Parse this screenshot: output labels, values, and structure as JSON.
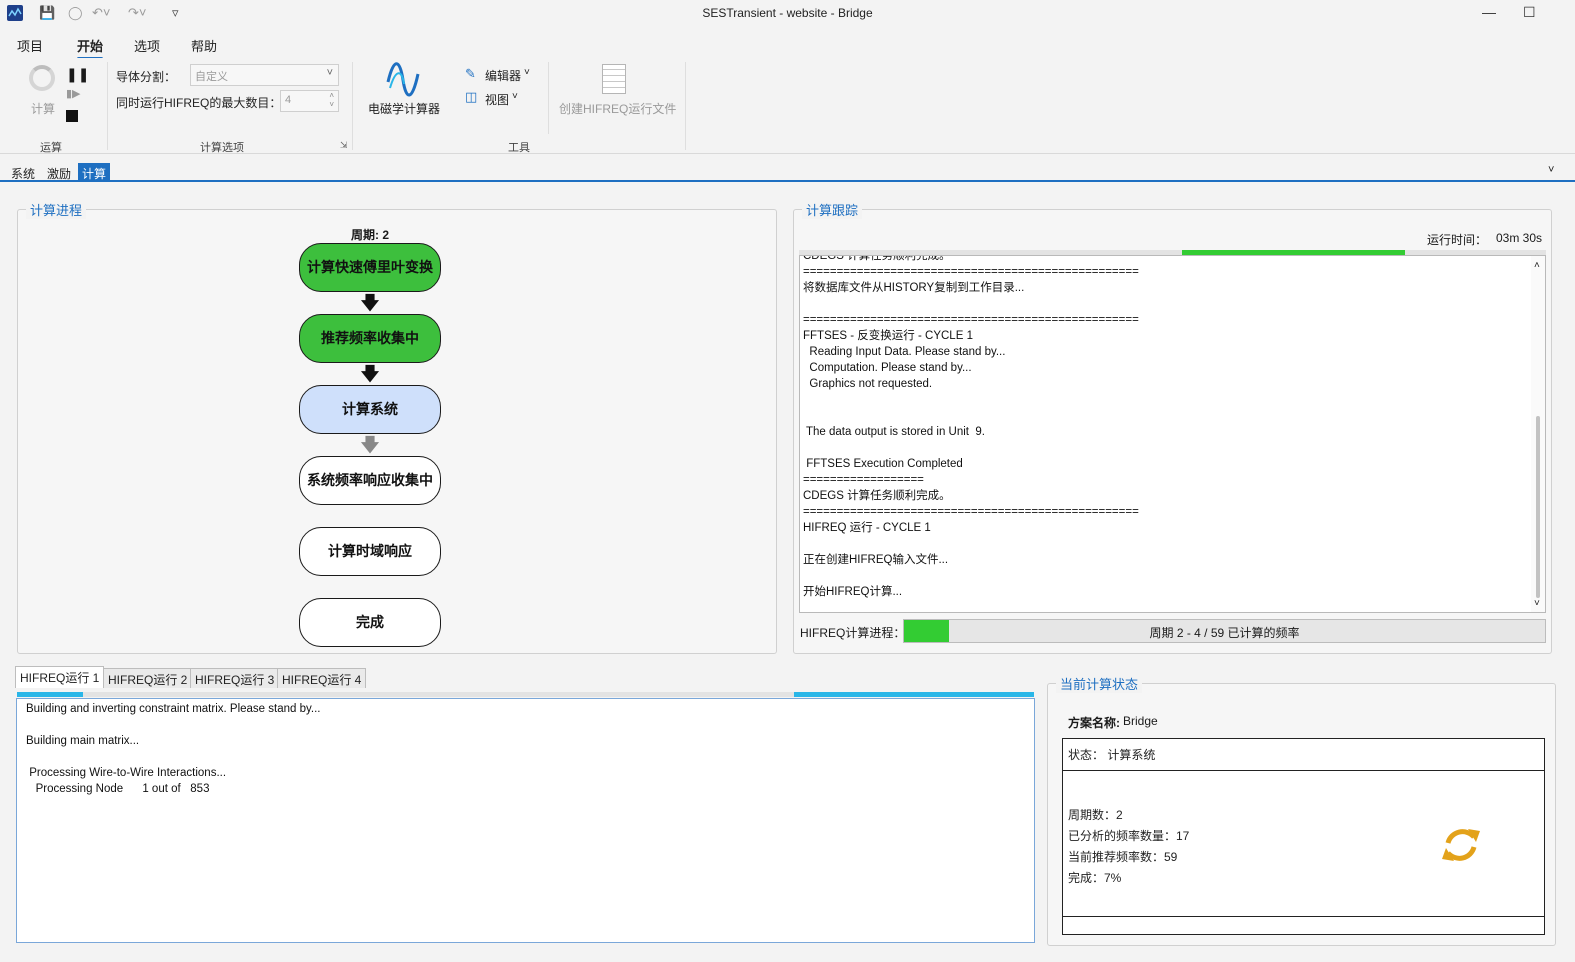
{
  "window": {
    "title": "SESTransient - website - Bridge"
  },
  "menu": {
    "items": [
      "项目",
      "开始",
      "选项",
      "帮助"
    ],
    "active": "开始"
  },
  "ribbon": {
    "run_group": {
      "label": "运算",
      "compute": "计算"
    },
    "options_group": {
      "label": "计算选项",
      "conductor_split_label": "导体分割：",
      "conductor_split_value": "自定义",
      "max_runs_label": "同时运行HIFREQ的最大数目：",
      "max_runs_value": "4"
    },
    "tools_group": {
      "label": "工具",
      "em_calculator": "电磁学计算器",
      "editor": "编辑器",
      "view": "视图",
      "create_hifreq": "创建HIFREQ运行文件"
    }
  },
  "page_tabs": [
    "系统",
    "激励",
    "计算"
  ],
  "progress_panel": {
    "title": "计算进程",
    "cycle_label": "周期: 2",
    "steps": [
      {
        "label": "计算快速傅里叶变换",
        "state": "done"
      },
      {
        "label": "推荐频率收集中",
        "state": "done"
      },
      {
        "label": "计算系统",
        "state": "current"
      },
      {
        "label": "系统频率响应收集中",
        "state": "pending"
      },
      {
        "label": "计算时域响应",
        "state": "pending"
      },
      {
        "label": "完成",
        "state": "pending"
      }
    ]
  },
  "trace_panel": {
    "title": "计算跟踪",
    "runtime_label": "运行时间：",
    "runtime_value": "03m 30s",
    "log": [
      "CDEGS 计算任务顺利完成。",
      "==================================================",
      "将数据库文件从HISTORY复制到工作目录...",
      "",
      "==================================================",
      "FFTSES - 反变换运行 - CYCLE 1",
      "  Reading Input Data. Please stand by...",
      "  Computation. Please stand by...",
      "  Graphics not requested.",
      "",
      "",
      " The data output is stored in Unit  9.",
      "",
      " FFTSES Execution Completed",
      "==================",
      "CDEGS 计算任务顺利完成。",
      "==================================================",
      "HIFREQ 运行 - CYCLE 1",
      "",
      "正在创建HIFREQ输入文件...",
      "",
      "开始HIFREQ计算..."
    ],
    "hifreq_progress_label": "HIFREQ计算进程：",
    "hifreq_progress_text": "周期 2 - 4 / 59 已计算的频率",
    "hifreq_progress_fraction": 0.07
  },
  "run_tabs": [
    "HIFREQ运行 1",
    "HIFREQ运行 2",
    "HIFREQ运行 3",
    "HIFREQ运行 4"
  ],
  "run_log": [
    "Building and inverting constraint matrix. Please stand by...",
    "",
    "Building main matrix...",
    "",
    " Processing Wire-to-Wire Interactions...",
    "   Processing Node      1 out of   853"
  ],
  "status_panel": {
    "title": "当前计算状态",
    "scheme_label": "方案名称:",
    "scheme_value": "Bridge",
    "state_text": "状态：  计算系统",
    "cycles": "周期数：2",
    "analyzed": "已分析的频率数量：17",
    "recommended": "当前推荐频率数：59",
    "complete": "完成：7%"
  },
  "colors": {
    "accent": "#1e6fc1",
    "done": "#3dbf3d",
    "current": "#cfe0fb",
    "progress": "#33cc33",
    "sync_icon": "#e3a21a"
  }
}
